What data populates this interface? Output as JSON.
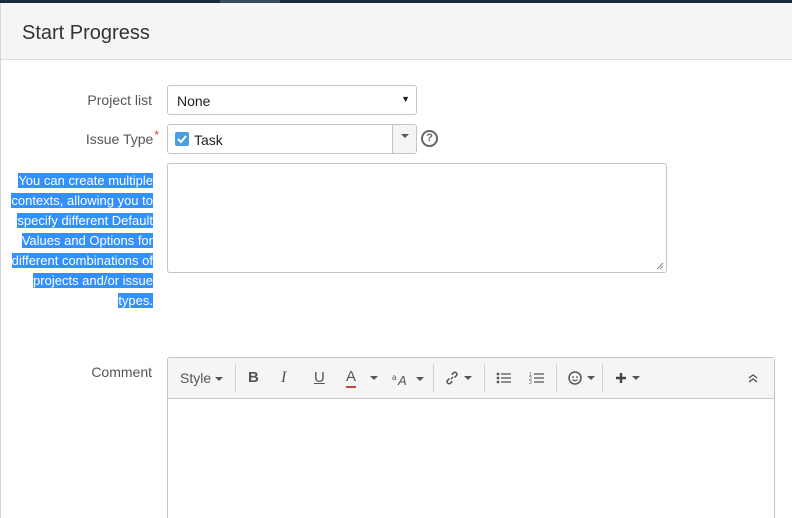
{
  "dialog": {
    "title": "Start Progress"
  },
  "fields": {
    "project_list": {
      "label": "Project list",
      "value": "None"
    },
    "issue_type": {
      "label": "Issue Type",
      "required_mark": "*",
      "value": "Task"
    },
    "description_label": "You can create multiple contexts, allowing you to specify different Default Values and Options for different combinations of projects and/or issue types.",
    "comment": {
      "label": "Comment"
    }
  },
  "toolbar": {
    "style_label": "Style",
    "bold": "B",
    "italic": "I",
    "underline": "U",
    "text_color": "A"
  },
  "colors": {
    "selection": "#3390ff",
    "checkbox": "#4a9fe0",
    "required": "#d04437",
    "text_color_underline": "#d04437"
  }
}
